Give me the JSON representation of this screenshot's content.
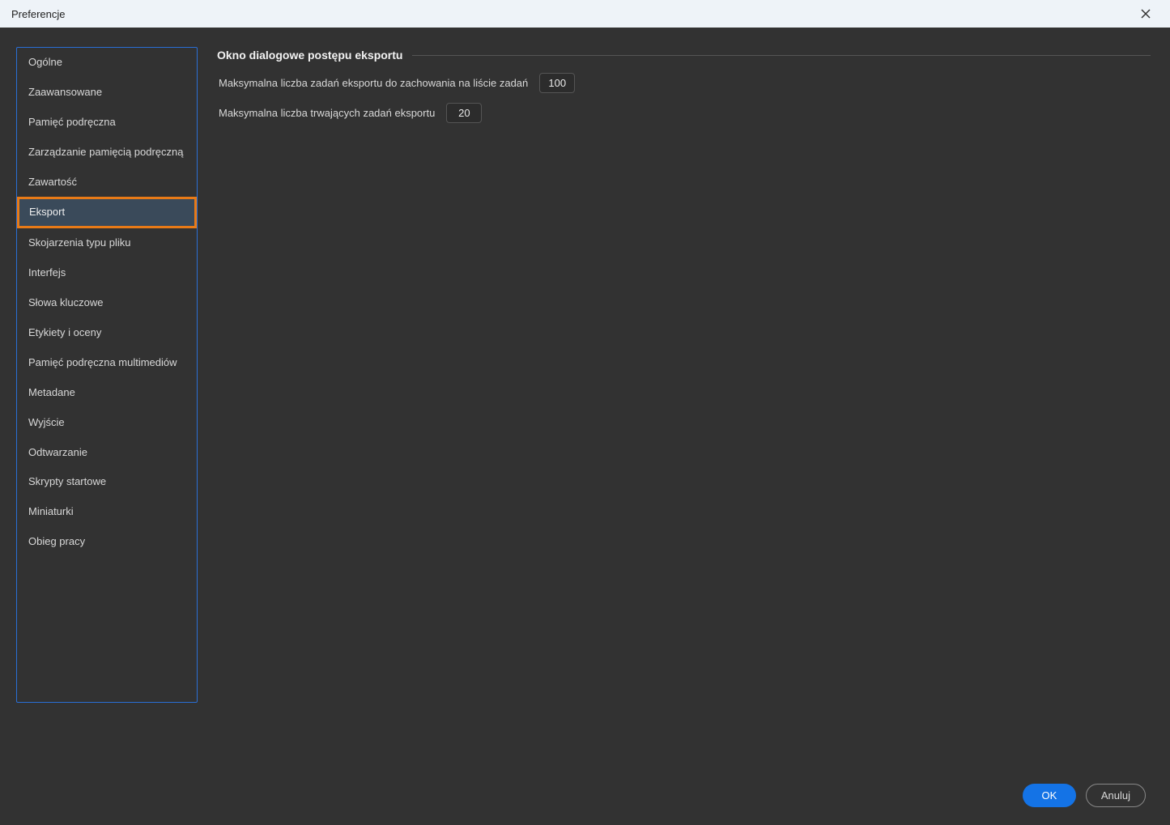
{
  "dialog": {
    "title": "Preferencje"
  },
  "sidebar": {
    "items": [
      {
        "label": "Ogólne",
        "selected": false
      },
      {
        "label": "Zaawansowane",
        "selected": false
      },
      {
        "label": "Pamięć podręczna",
        "selected": false
      },
      {
        "label": "Zarządzanie pamięcią podręczną",
        "selected": false
      },
      {
        "label": "Zawartość",
        "selected": false
      },
      {
        "label": "Eksport",
        "selected": true
      },
      {
        "label": "Skojarzenia typu pliku",
        "selected": false
      },
      {
        "label": "Interfejs",
        "selected": false
      },
      {
        "label": "Słowa kluczowe",
        "selected": false
      },
      {
        "label": "Etykiety i oceny",
        "selected": false
      },
      {
        "label": "Pamięć podręczna multimediów",
        "selected": false
      },
      {
        "label": "Metadane",
        "selected": false
      },
      {
        "label": "Wyjście",
        "selected": false
      },
      {
        "label": "Odtwarzanie",
        "selected": false
      },
      {
        "label": "Skrypty startowe",
        "selected": false
      },
      {
        "label": "Miniaturki",
        "selected": false
      },
      {
        "label": "Obieg pracy",
        "selected": false
      }
    ]
  },
  "main": {
    "section_title": "Okno dialogowe postępu eksportu",
    "settings": [
      {
        "label": "Maksymalna liczba zadań eksportu do zachowania na liście zadań",
        "value": "100"
      },
      {
        "label": "Maksymalna liczba trwających zadań eksportu",
        "value": "20"
      }
    ]
  },
  "footer": {
    "ok_label": "OK",
    "cancel_label": "Anuluj"
  }
}
